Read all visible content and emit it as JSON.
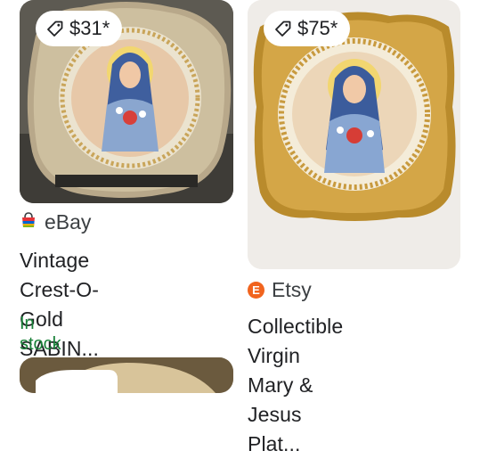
{
  "results": [
    {
      "price": "$31*",
      "source": "eBay",
      "title_line1": "Vintage Crest-O-",
      "title_line2": "Gold SABIN...",
      "stock": "In stock"
    },
    {
      "price": "$75*",
      "source": "Etsy",
      "title_line1": "Collectible Virgin",
      "title_line2": "Mary & Jesus Plat..."
    }
  ],
  "icons": {
    "price_tag": "tag-icon",
    "ebay": "ebay-bag-icon",
    "etsy": "etsy-logo-icon"
  },
  "colors": {
    "stock_green": "#188038",
    "etsy_orange": "#f1641e"
  }
}
